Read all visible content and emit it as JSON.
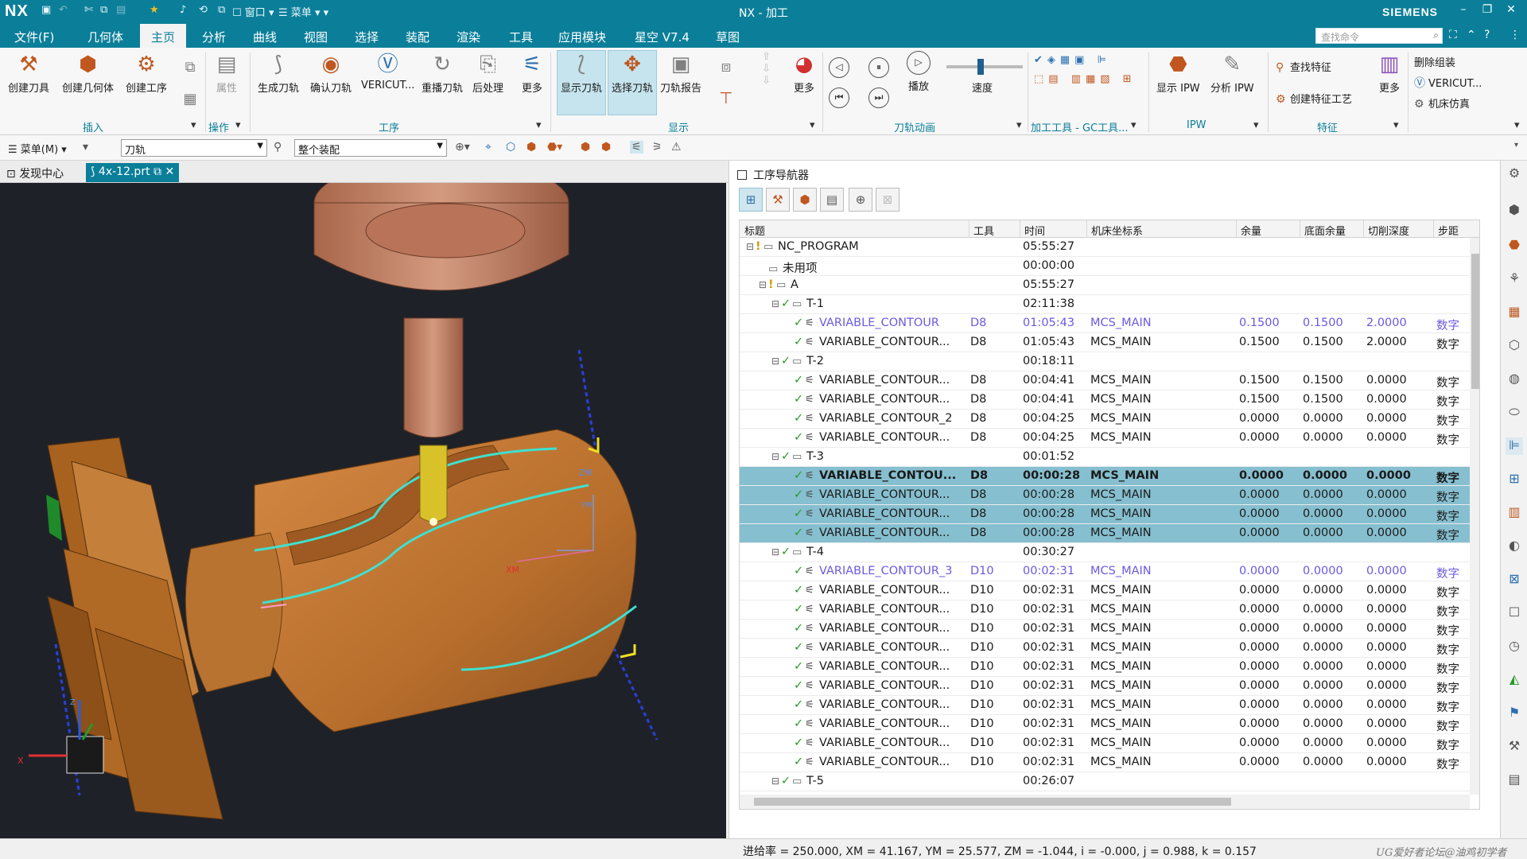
{
  "titlebar": {
    "app": "NX",
    "qa_window": "窗口",
    "qa_menu": "菜单",
    "title": "NX - 加工",
    "brand": "SIEMENS"
  },
  "menubar": {
    "items": [
      "文件(F)",
      "几何体",
      "主页",
      "分析",
      "曲线",
      "视图",
      "选择",
      "装配",
      "渲染",
      "工具",
      "应用模块",
      "星空 V7.4",
      "草图"
    ],
    "active": "主页",
    "search_placeholder": "查找命令"
  },
  "ribbon": {
    "insert": {
      "create_tool": "创建刀具",
      "create_geometry": "创建几何体",
      "create_operation": "创建工序",
      "group": "插入"
    },
    "operate": {
      "properties": "属性",
      "group": "操作"
    },
    "procedure": {
      "generate": "生成刀轨",
      "verify": "确认刀轨",
      "vericut": "VERICUT...",
      "replay": "重播刀轨",
      "postprocess": "后处理",
      "more": "更多",
      "group": "工序"
    },
    "display": {
      "show_path": "显示刀轨",
      "select_path": "选择刀轨",
      "report": "刀轨报告",
      "more": "更多",
      "group": "显示"
    },
    "animation": {
      "play": "播放",
      "speed": "速度",
      "group": "刀轨动画",
      "speed_level": 0.45
    },
    "gc": {
      "group": "加工工具 - GC工具..."
    },
    "ipw": {
      "show": "显示 IPW",
      "analyze": "分析 IPW",
      "group": "IPW"
    },
    "feature": {
      "find": "查找特征",
      "create_process": "创建特征工艺",
      "more": "更多",
      "group": "特征"
    },
    "extra": {
      "delete_assembly": "删除组装",
      "vericut": "VERICUT...",
      "machine_sim": "机床仿真"
    }
  },
  "selbar": {
    "menu": "菜单(M)",
    "filter": "刀轨",
    "scope": "整个装配"
  },
  "tabs": {
    "discovery": "发现中心",
    "part": "4x-12.prt"
  },
  "navigator": {
    "title": "工序导航器",
    "columns": [
      "标题",
      "工具",
      "时间",
      "机床坐标系",
      "余量",
      "底面余量",
      "切削深度",
      "步距"
    ],
    "rows": [
      {
        "indent": 0,
        "kind": "program",
        "title": "NC_PROGRAM",
        "tool": "",
        "time": "05:55:27",
        "mcs": "",
        "stock": "",
        "floor": "",
        "depth": "",
        "step": "",
        "style": ""
      },
      {
        "indent": 1,
        "kind": "folder",
        "title": "未用项",
        "tool": "",
        "time": "00:00:00",
        "mcs": "",
        "stock": "",
        "floor": "",
        "depth": "",
        "step": "",
        "style": ""
      },
      {
        "indent": 1,
        "kind": "program",
        "title": "A",
        "tool": "",
        "time": "05:55:27",
        "mcs": "",
        "stock": "",
        "floor": "",
        "depth": "",
        "step": "",
        "style": ""
      },
      {
        "indent": 2,
        "kind": "group",
        "title": "T-1",
        "tool": "",
        "time": "02:11:38",
        "mcs": "",
        "stock": "",
        "floor": "",
        "depth": "",
        "step": "",
        "style": ""
      },
      {
        "indent": 3,
        "kind": "op",
        "title": "VARIABLE_CONTOUR",
        "tool": "D8",
        "time": "01:05:43",
        "mcs": "MCS_MAIN",
        "stock": "0.1500",
        "floor": "0.1500",
        "depth": "2.0000",
        "step": "数字",
        "style": "purple"
      },
      {
        "indent": 3,
        "kind": "op",
        "title": "VARIABLE_CONTOUR...",
        "tool": "D8",
        "time": "01:05:43",
        "mcs": "MCS_MAIN",
        "stock": "0.1500",
        "floor": "0.1500",
        "depth": "2.0000",
        "step": "数字",
        "style": ""
      },
      {
        "indent": 2,
        "kind": "group",
        "title": "T-2",
        "tool": "",
        "time": "00:18:11",
        "mcs": "",
        "stock": "",
        "floor": "",
        "depth": "",
        "step": "",
        "style": ""
      },
      {
        "indent": 3,
        "kind": "op",
        "title": "VARIABLE_CONTOUR...",
        "tool": "D8",
        "time": "00:04:41",
        "mcs": "MCS_MAIN",
        "stock": "0.1500",
        "floor": "0.1500",
        "depth": "0.0000",
        "step": "数字",
        "style": ""
      },
      {
        "indent": 3,
        "kind": "op",
        "title": "VARIABLE_CONTOUR...",
        "tool": "D8",
        "time": "00:04:41",
        "mcs": "MCS_MAIN",
        "stock": "0.1500",
        "floor": "0.1500",
        "depth": "0.0000",
        "step": "数字",
        "style": ""
      },
      {
        "indent": 3,
        "kind": "op",
        "title": "VARIABLE_CONTOUR_2",
        "tool": "D8",
        "time": "00:04:25",
        "mcs": "MCS_MAIN",
        "stock": "0.0000",
        "floor": "0.0000",
        "depth": "0.0000",
        "step": "数字",
        "style": ""
      },
      {
        "indent": 3,
        "kind": "op",
        "title": "VARIABLE_CONTOUR...",
        "tool": "D8",
        "time": "00:04:25",
        "mcs": "MCS_MAIN",
        "stock": "0.0000",
        "floor": "0.0000",
        "depth": "0.0000",
        "step": "数字",
        "style": ""
      },
      {
        "indent": 2,
        "kind": "group",
        "title": "T-3",
        "tool": "",
        "time": "00:01:52",
        "mcs": "",
        "stock": "",
        "floor": "",
        "depth": "",
        "step": "",
        "style": ""
      },
      {
        "indent": 3,
        "kind": "op",
        "title": "VARIABLE_CONTOU...",
        "tool": "D8",
        "time": "00:00:28",
        "mcs": "MCS_MAIN",
        "stock": "0.0000",
        "floor": "0.0000",
        "depth": "0.0000",
        "step": "数字",
        "style": "sel bold"
      },
      {
        "indent": 3,
        "kind": "op",
        "title": "VARIABLE_CONTOUR...",
        "tool": "D8",
        "time": "00:00:28",
        "mcs": "MCS_MAIN",
        "stock": "0.0000",
        "floor": "0.0000",
        "depth": "0.0000",
        "step": "数字",
        "style": "sel"
      },
      {
        "indent": 3,
        "kind": "op",
        "title": "VARIABLE_CONTOUR...",
        "tool": "D8",
        "time": "00:00:28",
        "mcs": "MCS_MAIN",
        "stock": "0.0000",
        "floor": "0.0000",
        "depth": "0.0000",
        "step": "数字",
        "style": "sel"
      },
      {
        "indent": 3,
        "kind": "op",
        "title": "VARIABLE_CONTOUR...",
        "tool": "D8",
        "time": "00:00:28",
        "mcs": "MCS_MAIN",
        "stock": "0.0000",
        "floor": "0.0000",
        "depth": "0.0000",
        "step": "数字",
        "style": "sel"
      },
      {
        "indent": 2,
        "kind": "group",
        "title": "T-4",
        "tool": "",
        "time": "00:30:27",
        "mcs": "",
        "stock": "",
        "floor": "",
        "depth": "",
        "step": "",
        "style": ""
      },
      {
        "indent": 3,
        "kind": "op",
        "title": "VARIABLE_CONTOUR_3",
        "tool": "D10",
        "time": "00:02:31",
        "mcs": "MCS_MAIN",
        "stock": "0.0000",
        "floor": "0.0000",
        "depth": "0.0000",
        "step": "数字",
        "style": "purple"
      },
      {
        "indent": 3,
        "kind": "op",
        "title": "VARIABLE_CONTOUR...",
        "tool": "D10",
        "time": "00:02:31",
        "mcs": "MCS_MAIN",
        "stock": "0.0000",
        "floor": "0.0000",
        "depth": "0.0000",
        "step": "数字",
        "style": ""
      },
      {
        "indent": 3,
        "kind": "op",
        "title": "VARIABLE_CONTOUR...",
        "tool": "D10",
        "time": "00:02:31",
        "mcs": "MCS_MAIN",
        "stock": "0.0000",
        "floor": "0.0000",
        "depth": "0.0000",
        "step": "数字",
        "style": ""
      },
      {
        "indent": 3,
        "kind": "op",
        "title": "VARIABLE_CONTOUR...",
        "tool": "D10",
        "time": "00:02:31",
        "mcs": "MCS_MAIN",
        "stock": "0.0000",
        "floor": "0.0000",
        "depth": "0.0000",
        "step": "数字",
        "style": ""
      },
      {
        "indent": 3,
        "kind": "op",
        "title": "VARIABLE_CONTOUR...",
        "tool": "D10",
        "time": "00:02:31",
        "mcs": "MCS_MAIN",
        "stock": "0.0000",
        "floor": "0.0000",
        "depth": "0.0000",
        "step": "数字",
        "style": ""
      },
      {
        "indent": 3,
        "kind": "op",
        "title": "VARIABLE_CONTOUR...",
        "tool": "D10",
        "time": "00:02:31",
        "mcs": "MCS_MAIN",
        "stock": "0.0000",
        "floor": "0.0000",
        "depth": "0.0000",
        "step": "数字",
        "style": ""
      },
      {
        "indent": 3,
        "kind": "op",
        "title": "VARIABLE_CONTOUR...",
        "tool": "D10",
        "time": "00:02:31",
        "mcs": "MCS_MAIN",
        "stock": "0.0000",
        "floor": "0.0000",
        "depth": "0.0000",
        "step": "数字",
        "style": ""
      },
      {
        "indent": 3,
        "kind": "op",
        "title": "VARIABLE_CONTOUR...",
        "tool": "D10",
        "time": "00:02:31",
        "mcs": "MCS_MAIN",
        "stock": "0.0000",
        "floor": "0.0000",
        "depth": "0.0000",
        "step": "数字",
        "style": ""
      },
      {
        "indent": 3,
        "kind": "op",
        "title": "VARIABLE_CONTOUR...",
        "tool": "D10",
        "time": "00:02:31",
        "mcs": "MCS_MAIN",
        "stock": "0.0000",
        "floor": "0.0000",
        "depth": "0.0000",
        "step": "数字",
        "style": ""
      },
      {
        "indent": 3,
        "kind": "op",
        "title": "VARIABLE_CONTOUR...",
        "tool": "D10",
        "time": "00:02:31",
        "mcs": "MCS_MAIN",
        "stock": "0.0000",
        "floor": "0.0000",
        "depth": "0.0000",
        "step": "数字",
        "style": ""
      },
      {
        "indent": 3,
        "kind": "op",
        "title": "VARIABLE_CONTOUR...",
        "tool": "D10",
        "time": "00:02:31",
        "mcs": "MCS_MAIN",
        "stock": "0.0000",
        "floor": "0.0000",
        "depth": "0.0000",
        "step": "数字",
        "style": ""
      },
      {
        "indent": 2,
        "kind": "group",
        "title": "T-5",
        "tool": "",
        "time": "00:26:07",
        "mcs": "",
        "stock": "",
        "floor": "",
        "depth": "",
        "step": "",
        "style": ""
      }
    ]
  },
  "viewport": {
    "labels": {
      "xm": "XM",
      "zm": "ZM",
      "ym": "YM",
      "x": "X",
      "z": "Z"
    },
    "colors": {
      "part": "#c27a34",
      "path": "#3fe0d0",
      "background": "#1e2228"
    }
  },
  "status": {
    "readout": "进给率 = 250.000, XM = 41.167, YM = 25.577, ZM = -1.044, i = -0.000, j = 0.988, k = 0.157",
    "watermark": "UG爱好者论坛@油鸡初学者"
  },
  "colors": {
    "accent": "#0b7f99",
    "selection": "#86bfcf",
    "check": "#2a9a2a",
    "purple_text": "#6a5ae0"
  }
}
